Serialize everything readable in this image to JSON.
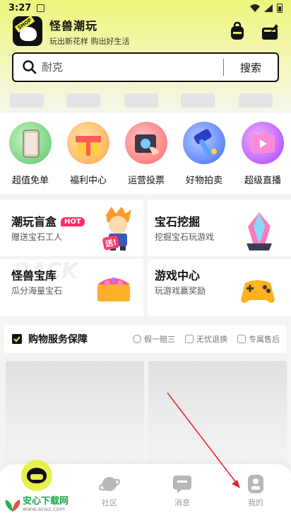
{
  "status_bar": {
    "time": "3:27"
  },
  "header": {
    "logo_text": "SHOP",
    "app_name": "怪兽潮玩",
    "slogan": "玩出新花样 购出好生活"
  },
  "search": {
    "placeholder": "耐克",
    "button_label": "搜索"
  },
  "quick_menu": [
    {
      "label": "超值免单",
      "icon": "phone-icon",
      "color": "#7fd98a"
    },
    {
      "label": "福利中心",
      "icon": "gift-box-icon",
      "color": "#ffb24a"
    },
    {
      "label": "运营投票",
      "icon": "camera-vote-icon",
      "color": "#ff7a7a"
    },
    {
      "label": "好物拍卖",
      "icon": "auction-hammer-icon",
      "color": "#4b7bff"
    },
    {
      "label": "超级直播",
      "icon": "live-tv-icon",
      "color": "#b24aff"
    }
  ],
  "feature_cards": [
    {
      "title": "潮玩盲盒",
      "badge": "HOT",
      "subtitle": "赠送宝石工人",
      "bubble": "送!"
    },
    {
      "title": "宝石挖掘",
      "subtitle": "挖掘宝石玩游戏"
    },
    {
      "title": "怪兽宝库",
      "subtitle": "瓜分海量宝石",
      "watermark": "BACK"
    },
    {
      "title": "游戏中心",
      "subtitle": "玩游戏赢奖励"
    }
  ],
  "guarantee": {
    "title": "购物服务保障",
    "items": [
      "假一赔三",
      "无忧退换",
      "专属售后"
    ]
  },
  "bottom_nav": [
    {
      "label": "",
      "icon": "monster-home-icon"
    },
    {
      "label": "社区",
      "icon": "planet-icon"
    },
    {
      "label": "消息",
      "icon": "message-icon"
    },
    {
      "label": "我的",
      "icon": "profile-icon"
    }
  ],
  "watermark": {
    "title": "安心下载网",
    "url": "www.anxz.com"
  },
  "colors": {
    "accent": "#e8f04a",
    "hot": "#ff2e63",
    "arrow": "#e0282a"
  }
}
